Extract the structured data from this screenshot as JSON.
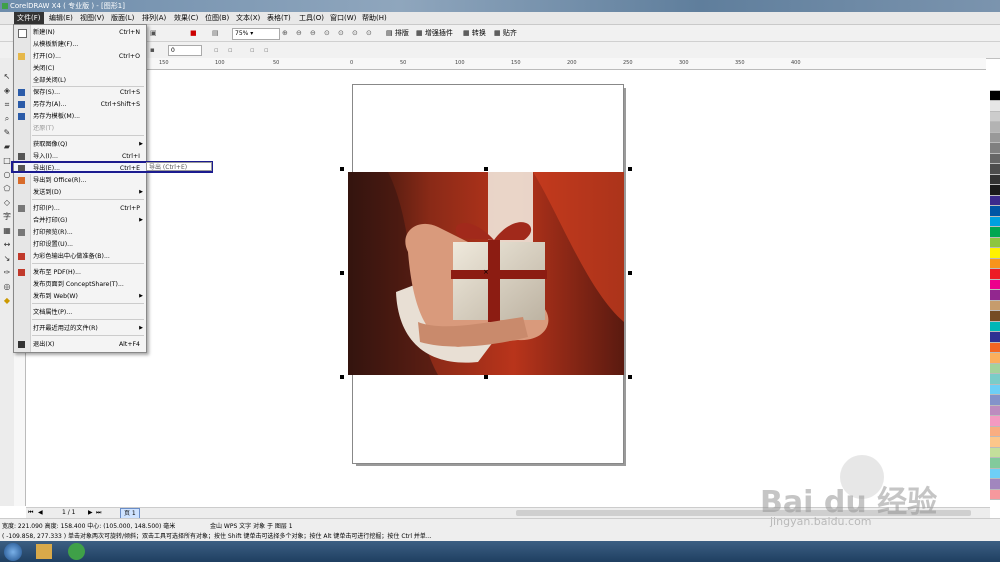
{
  "window": {
    "title": "CorelDRAW X4 ( 专业版 ) - [图形1]"
  },
  "menubar": [
    {
      "label": "文件(F)",
      "active": true
    },
    {
      "label": "编辑(E)"
    },
    {
      "label": "视图(V)"
    },
    {
      "label": "版面(L)"
    },
    {
      "label": "排列(A)"
    },
    {
      "label": "效果(C)"
    },
    {
      "label": "位图(B)"
    },
    {
      "label": "文本(X)"
    },
    {
      "label": "表格(T)"
    },
    {
      "label": "工具(O)"
    },
    {
      "label": "窗口(W)"
    },
    {
      "label": "帮助(H)"
    }
  ],
  "toolbar": {
    "zoom": "75%",
    "layout_label": "排版",
    "plugin_label": "增强插件",
    "convert_label": "转换",
    "paste_label": "贴齐",
    "angle_value": "0"
  },
  "file_menu": [
    {
      "label": "新建(N)",
      "shortcut": "Ctrl+N",
      "icon": "new-doc-icon"
    },
    {
      "label": "从模板新建(F)...",
      "shortcut": ""
    },
    {
      "label": "打开(O)...",
      "shortcut": "Ctrl+O",
      "icon": "open-folder-icon"
    },
    {
      "label": "关闭(C)",
      "shortcut": ""
    },
    {
      "label": "全部关闭(L)",
      "shortcut": ""
    },
    {
      "label": "保存(S)...",
      "shortcut": "Ctrl+S",
      "icon": "save-icon"
    },
    {
      "label": "另存为(A)...",
      "shortcut": "Ctrl+Shift+S",
      "icon": "save-as-icon"
    },
    {
      "label": "另存为模板(M)...",
      "shortcut": "",
      "icon": "template-icon"
    },
    {
      "label": "还原(T)",
      "shortcut": "",
      "disabled": true
    },
    {
      "label": "获取图像(Q)",
      "shortcut": "",
      "submenu": true
    },
    {
      "label": "导入(I)...",
      "shortcut": "Ctrl+I",
      "icon": "import-icon"
    },
    {
      "label": "导出(E)...",
      "shortcut": "Ctrl+E",
      "icon": "export-icon",
      "highlighted": true
    },
    {
      "label": "导出到 Office(R)...",
      "shortcut": "",
      "icon": "office-icon"
    },
    {
      "label": "发送到(D)",
      "shortcut": "",
      "submenu": true
    },
    {
      "label": "打印(P)...",
      "shortcut": "Ctrl+P",
      "icon": "print-icon"
    },
    {
      "label": "合并打印(G)",
      "shortcut": "",
      "submenu": true
    },
    {
      "label": "打印预览(R)...",
      "shortcut": "",
      "icon": "preview-icon"
    },
    {
      "label": "打印设置(U)...",
      "shortcut": ""
    },
    {
      "label": "为彩色输出中心做准备(B)...",
      "shortcut": "",
      "icon": "color-icon"
    },
    {
      "label": "发布至 PDF(H)...",
      "shortcut": "",
      "icon": "pdf-icon"
    },
    {
      "label": "发布页面到 ConceptShare(T)...",
      "shortcut": ""
    },
    {
      "label": "发布到 Web(W)",
      "shortcut": "",
      "submenu": true
    },
    {
      "label": "文档属性(P)...",
      "shortcut": ""
    },
    {
      "label": "打开最近用过的文件(R)",
      "shortcut": "",
      "submenu": true
    },
    {
      "label": "退出(X)",
      "shortcut": "Alt+F4",
      "icon": "exit-icon"
    }
  ],
  "tooltip": "导出 (Ctrl+E)",
  "ruler": {
    "h_ticks": [
      "150",
      "100",
      "50",
      "0",
      "50",
      "100",
      "150",
      "200",
      "250",
      "300",
      "350",
      "400"
    ]
  },
  "page_nav": {
    "counter": "1 / 1",
    "tab": "页 1"
  },
  "status": {
    "line1": "宽度: 221.090  高度: 158.400  中心: (105.000, 148.500)  毫米",
    "line1b": "金山 WPS 文字 对象 于 图层 1",
    "line2": "( -109.858, 277.333 )   单击对象两次可旋转/倾斜；双击工具可选择所有对象；按住 Shift 键单击可选择多个对象；按住 Alt 键单击可进行挖掘；按住 Ctrl 并单..."
  },
  "watermark": {
    "text": "Bai du 经验",
    "url": "jingyan.baidu.com"
  },
  "palette_colors": [
    "#ffffff",
    "#000000",
    "#e6e6e6",
    "#cccccc",
    "#b3b3b3",
    "#999999",
    "#808080",
    "#666666",
    "#4d4d4d",
    "#333333",
    "#1a1a1a",
    "#3c2a8c",
    "#0055a5",
    "#00a0e0",
    "#00a651",
    "#8dc63f",
    "#fff200",
    "#f7941d",
    "#ed1c24",
    "#ec008c",
    "#92278f",
    "#c69c6d",
    "#754c24",
    "#00b7b7",
    "#2e3192",
    "#f26522",
    "#fbaf5d",
    "#a3d39c",
    "#7accc8",
    "#6dcff6",
    "#8393ca",
    "#bd8cbf",
    "#f49ac1",
    "#f9ad81",
    "#fdc68a",
    "#c4df9b",
    "#82ca9c",
    "#6ecff6",
    "#a186be",
    "#f6989d"
  ]
}
